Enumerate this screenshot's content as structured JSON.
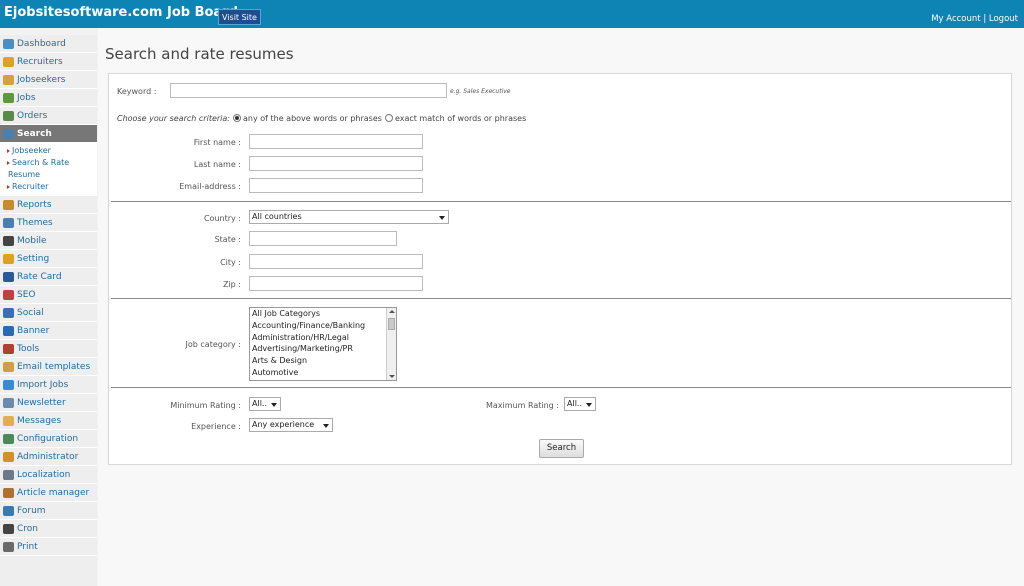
{
  "header": {
    "brand": "Ejobsitesoftware.com Job Board",
    "visit_site": "Visit Site",
    "my_account": "My Account",
    "separator": "|",
    "logout": "Logout"
  },
  "sidebar": {
    "items_top": [
      {
        "label": "Dashboard",
        "icon": "home-icon",
        "color": "#4a8fc4"
      },
      {
        "label": "Recruiters",
        "icon": "user-icon",
        "color": "#e0a030"
      },
      {
        "label": "Jobseekers",
        "icon": "users-icon",
        "color": "#d4a040"
      },
      {
        "label": "Jobs",
        "icon": "people-icon",
        "color": "#5a9a3a"
      },
      {
        "label": "Orders",
        "icon": "cash-icon",
        "color": "#5a8a4a"
      },
      {
        "label": "Search",
        "icon": "search-icon",
        "color": "#4a7fb0"
      }
    ],
    "sub_items": [
      "Jobseeker",
      "Search & Rate Resume",
      "Recruiter"
    ],
    "items_bottom": [
      {
        "label": "Reports",
        "icon": "book-icon",
        "color": "#c88a2a"
      },
      {
        "label": "Themes",
        "icon": "grid-icon",
        "color": "#4a7fb0"
      },
      {
        "label": "Mobile",
        "icon": "mobile-icon",
        "color": "#444444"
      },
      {
        "label": "Setting",
        "icon": "gear-icon",
        "color": "#e0a020"
      },
      {
        "label": "Rate Card",
        "icon": "dollar-icon",
        "color": "#2a5a9a"
      },
      {
        "label": "SEO",
        "icon": "chart-icon",
        "color": "#c04040"
      },
      {
        "label": "Social",
        "icon": "globe-icon",
        "color": "#3a6fb0"
      },
      {
        "label": "Banner",
        "icon": "palette-icon",
        "color": "#2a6ab0"
      },
      {
        "label": "Tools",
        "icon": "tools-icon",
        "color": "#b04030"
      },
      {
        "label": "Email templates",
        "icon": "mail-icon",
        "color": "#d0a040"
      },
      {
        "label": "Import Jobs",
        "icon": "import-icon",
        "color": "#3a8ad0"
      },
      {
        "label": "Newsletter",
        "icon": "newsletter-icon",
        "color": "#6a8ab0"
      },
      {
        "label": "Messages",
        "icon": "message-icon",
        "color": "#e0b050"
      },
      {
        "label": "Configuration",
        "icon": "config-icon",
        "color": "#4a8a5a"
      },
      {
        "label": "Administrator",
        "icon": "admin-icon",
        "color": "#d09030"
      },
      {
        "label": "Localization",
        "icon": "clock-icon",
        "color": "#6a7a8a"
      },
      {
        "label": "Article manager",
        "icon": "pen-icon",
        "color": "#b07030"
      },
      {
        "label": "Forum",
        "icon": "forum-icon",
        "color": "#3a7ab0"
      },
      {
        "label": "Cron",
        "icon": "cron-clock-icon",
        "color": "#444444"
      },
      {
        "label": "Print",
        "icon": "printer-icon",
        "color": "#6a6a6a"
      }
    ]
  },
  "page": {
    "title": "Search and rate resumes"
  },
  "form": {
    "keyword_label": "Keyword :",
    "keyword_hint": "e.g. Sales Executive",
    "criteria_label": "Choose your search criteria:",
    "criteria_any": "any of the above words or phrases",
    "criteria_exact": "exact match of words or phrases",
    "first_name_label": "First name :",
    "last_name_label": "Last name :",
    "email_label": "Email-address :",
    "country_label": "Country :",
    "country_value": "All countries",
    "state_label": "State :",
    "city_label": "City :",
    "zip_label": "Zip :",
    "job_category_label": "Job category :",
    "job_categories": [
      "All Job Categorys",
      "Accounting/Finance/Banking",
      "Administration/HR/Legal",
      "Advertising/Marketing/PR",
      "Arts & Design",
      "Automotive"
    ],
    "min_rating_label": "Minimum Rating :",
    "min_rating_value": "All..",
    "max_rating_label": "Maximum Rating :",
    "max_rating_value": "All..",
    "experience_label": "Experience :",
    "experience_value": "Any experience",
    "search_button": "Search"
  }
}
